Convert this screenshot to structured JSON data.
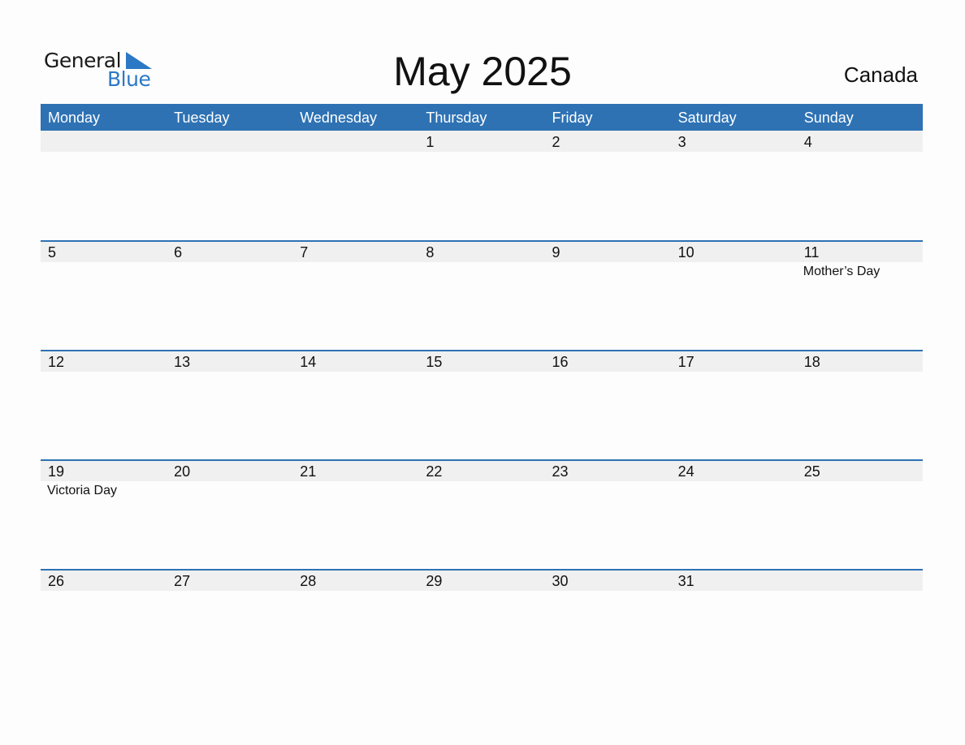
{
  "logo": {
    "line1": "General",
    "line2": "Blue",
    "icon": "triangle-flag-icon"
  },
  "title": "May 2025",
  "country": "Canada",
  "colors": {
    "accent": "#2e72b4",
    "strip": "#f0f0f0",
    "logo_blue": "#2b78c5"
  },
  "weekdays": [
    "Monday",
    "Tuesday",
    "Wednesday",
    "Thursday",
    "Friday",
    "Saturday",
    "Sunday"
  ],
  "weeks": [
    {
      "days": [
        {
          "num": "",
          "event": ""
        },
        {
          "num": "",
          "event": ""
        },
        {
          "num": "",
          "event": ""
        },
        {
          "num": "1",
          "event": ""
        },
        {
          "num": "2",
          "event": ""
        },
        {
          "num": "3",
          "event": ""
        },
        {
          "num": "4",
          "event": ""
        }
      ]
    },
    {
      "days": [
        {
          "num": "5",
          "event": ""
        },
        {
          "num": "6",
          "event": ""
        },
        {
          "num": "7",
          "event": ""
        },
        {
          "num": "8",
          "event": ""
        },
        {
          "num": "9",
          "event": ""
        },
        {
          "num": "10",
          "event": ""
        },
        {
          "num": "11",
          "event": "Mother’s Day"
        }
      ]
    },
    {
      "days": [
        {
          "num": "12",
          "event": ""
        },
        {
          "num": "13",
          "event": ""
        },
        {
          "num": "14",
          "event": ""
        },
        {
          "num": "15",
          "event": ""
        },
        {
          "num": "16",
          "event": ""
        },
        {
          "num": "17",
          "event": ""
        },
        {
          "num": "18",
          "event": ""
        }
      ]
    },
    {
      "days": [
        {
          "num": "19",
          "event": "Victoria Day"
        },
        {
          "num": "20",
          "event": ""
        },
        {
          "num": "21",
          "event": ""
        },
        {
          "num": "22",
          "event": ""
        },
        {
          "num": "23",
          "event": ""
        },
        {
          "num": "24",
          "event": ""
        },
        {
          "num": "25",
          "event": ""
        }
      ]
    },
    {
      "days": [
        {
          "num": "26",
          "event": ""
        },
        {
          "num": "27",
          "event": ""
        },
        {
          "num": "28",
          "event": ""
        },
        {
          "num": "29",
          "event": ""
        },
        {
          "num": "30",
          "event": ""
        },
        {
          "num": "31",
          "event": ""
        },
        {
          "num": "",
          "event": ""
        }
      ]
    }
  ]
}
